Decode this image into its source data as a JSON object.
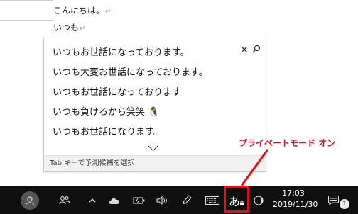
{
  "document": {
    "line1": "こんにちは。",
    "line1_mark": "↵",
    "line2": "いつも",
    "line2_mark": "↵"
  },
  "ime_popup": {
    "candidates": [
      "いつもお世話になっております。",
      "いつも大変お世話になっております。",
      "いつもお世話になっております",
      "いつも負けるから笑笑 🐧",
      "いつもお世話になります。"
    ],
    "close_glyph": "✕",
    "search_glyph": "⚲",
    "footer_hint": "Tab キーで予測候補を選択"
  },
  "annotation": {
    "label": "プライベートモード オン",
    "color": "#e0101a"
  },
  "taskbar": {
    "ime_mode": "あ",
    "time": "17:03",
    "date": "2019/11/30",
    "notification_count": "1"
  }
}
